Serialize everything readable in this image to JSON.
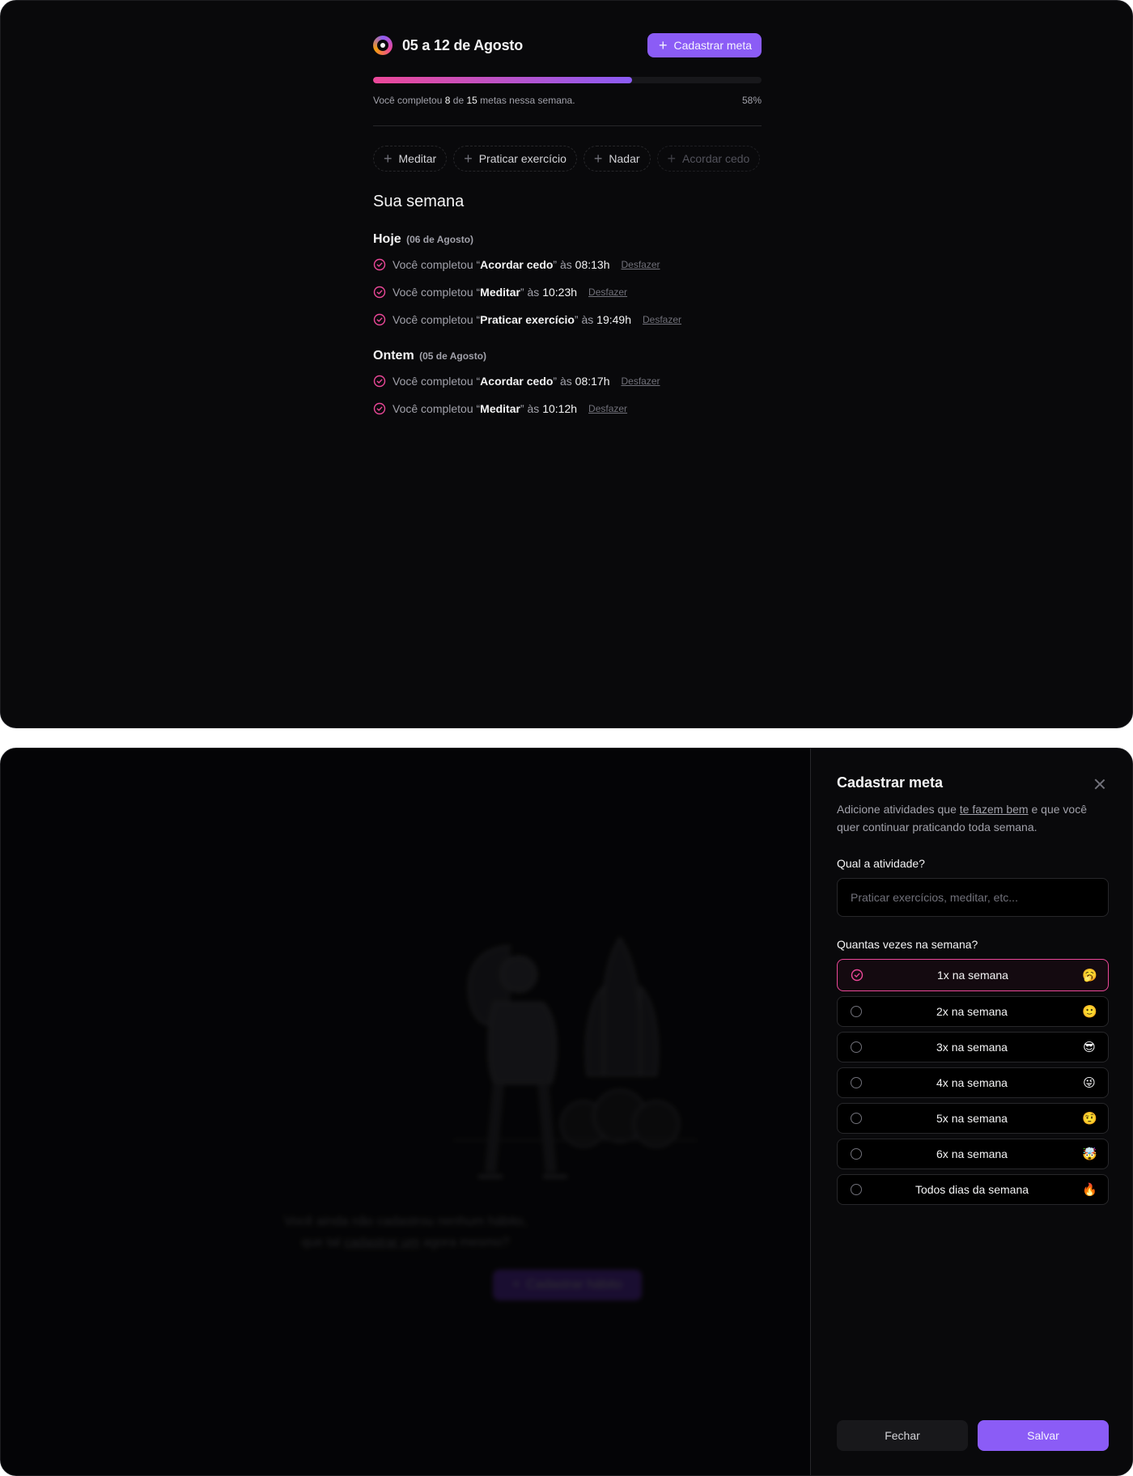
{
  "summary": {
    "title": "05 a 12 de Agosto",
    "create_button_label": "Cadastrar meta",
    "progress": {
      "completed": "8",
      "total": "15",
      "percentage_label": "58%",
      "percentage_value": 0.667,
      "text_prefix": "Você completou",
      "text_of": "de",
      "text_suffix": "metas nessa semana."
    }
  },
  "pending_goals": [
    {
      "label": "Meditar",
      "disabled": false
    },
    {
      "label": "Praticar exercício",
      "disabled": false
    },
    {
      "label": "Nadar",
      "disabled": false
    },
    {
      "label": "Acordar cedo",
      "disabled": true
    }
  ],
  "week": {
    "section_title": "Sua semana",
    "days": [
      {
        "label": "Hoje",
        "date": "(06 de Agosto)",
        "entries": [
          {
            "prefix": "Você completou “",
            "goal": "Acordar cedo",
            "middle": "” às",
            "time": "08:13h",
            "undo": "Desfazer"
          },
          {
            "prefix": "Você completou “",
            "goal": "Meditar",
            "middle": "” às",
            "time": "10:23h",
            "undo": "Desfazer"
          },
          {
            "prefix": "Você completou “",
            "goal": "Praticar exercício",
            "middle": "” às",
            "time": "19:49h",
            "undo": "Desfazer"
          }
        ]
      },
      {
        "label": "Ontem",
        "date": "(05 de Agosto)",
        "entries": [
          {
            "prefix": "Você completou “",
            "goal": "Acordar cedo",
            "middle": "” às",
            "time": "08:17h",
            "undo": "Desfazer"
          },
          {
            "prefix": "Você completou “",
            "goal": "Meditar",
            "middle": "” às",
            "time": "10:12h",
            "undo": "Desfazer"
          }
        ]
      }
    ]
  },
  "empty_state": {
    "line1": "Você ainda não cadastrou nenhum hábito,",
    "line2_prefix": "que tal",
    "line2_link": "cadastrar um",
    "line2_suffix": "agora mesmo?",
    "button_label": "Cadastrar hábito"
  },
  "drawer": {
    "title": "Cadastrar meta",
    "desc_prefix": "Adicione atividades que",
    "desc_link": "te fazem bem",
    "desc_suffix": "e que você quer continuar praticando toda semana.",
    "activity_label": "Qual a atividade?",
    "activity_placeholder": "Praticar exercícios, meditar, etc...",
    "activity_value": "",
    "frequency_label": "Quantas vezes na semana?",
    "options": [
      {
        "label": "1x na semana",
        "emoji": "🥱",
        "selected": true
      },
      {
        "label": "2x na semana",
        "emoji": "🙂",
        "selected": false
      },
      {
        "label": "3x na semana",
        "emoji": "😎",
        "selected": false
      },
      {
        "label": "4x na semana",
        "emoji": "😜",
        "selected": false
      },
      {
        "label": "5x na semana",
        "emoji": "🤨",
        "selected": false
      },
      {
        "label": "6x na semana",
        "emoji": "🤯",
        "selected": false
      },
      {
        "label": "Todos dias da semana",
        "emoji": "🔥",
        "selected": false
      }
    ],
    "close_label": "Fechar",
    "save_label": "Salvar"
  },
  "colors": {
    "background": "#09090b",
    "accent_violet": "#8b5cf6",
    "accent_pink": "#ec4899"
  }
}
